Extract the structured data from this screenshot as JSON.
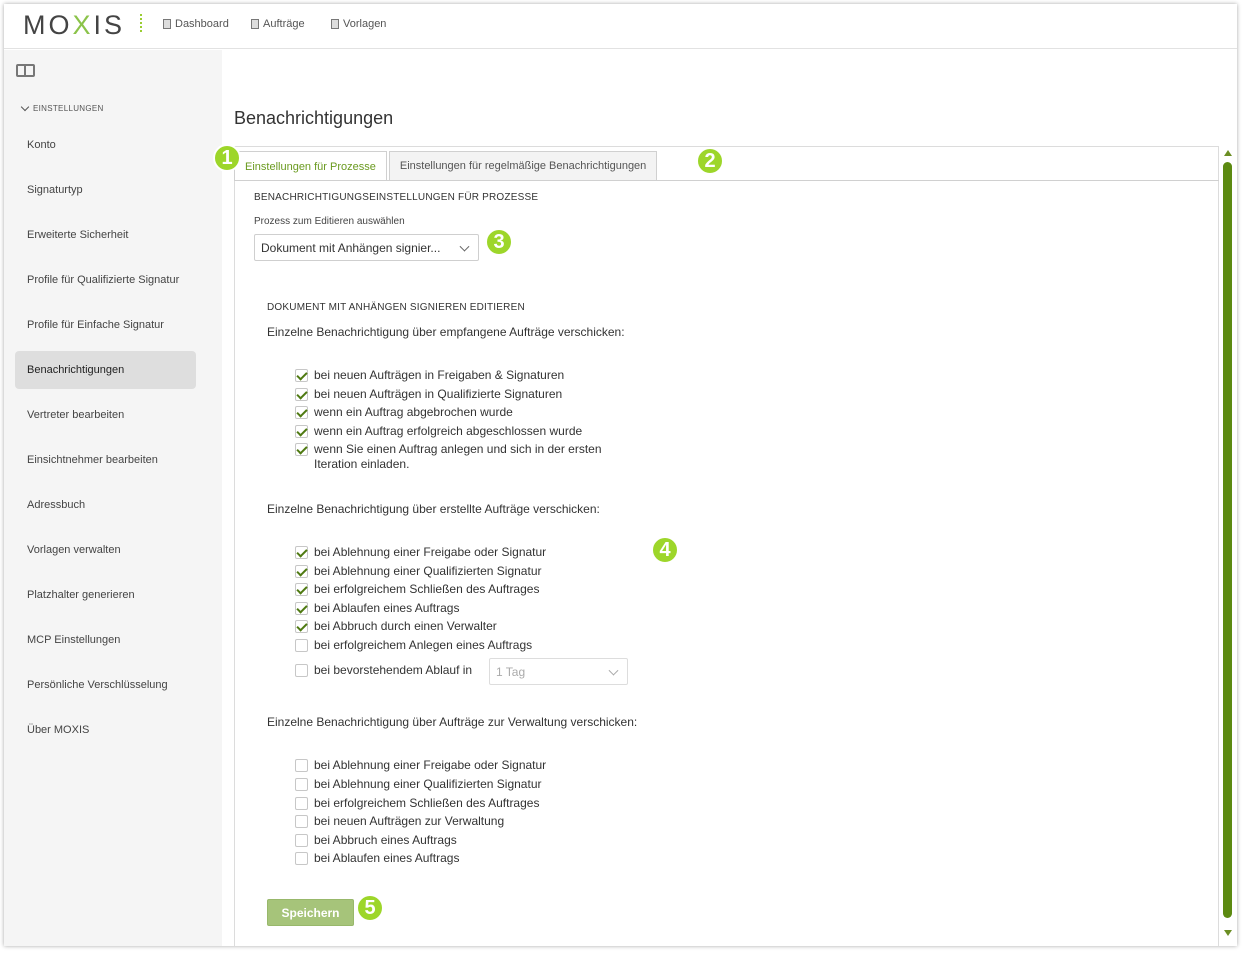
{
  "app": {
    "logo_text_1": "MO",
    "logo_x": "X",
    "logo_text_2": "IS"
  },
  "topnav": [
    {
      "label": "Dashboard"
    },
    {
      "label": "Aufträge"
    },
    {
      "label": "Vorlagen"
    }
  ],
  "sidebar": {
    "section": "EINSTELLUNGEN",
    "items": [
      {
        "label": "Konto"
      },
      {
        "label": "Signaturtyp"
      },
      {
        "label": "Erweiterte Sicherheit"
      },
      {
        "label": "Profile für Qualifizierte Signatur"
      },
      {
        "label": "Profile für Einfache Signatur"
      },
      {
        "label": "Benachrichtigungen",
        "active": true
      },
      {
        "label": "Vertreter bearbeiten"
      },
      {
        "label": "Einsichtnehmer bearbeiten"
      },
      {
        "label": "Adressbuch"
      },
      {
        "label": "Vorlagen verwalten"
      },
      {
        "label": "Platzhalter generieren"
      },
      {
        "label": "MCP Einstellungen"
      },
      {
        "label": "Persönliche Verschlüsselung"
      },
      {
        "label": "Über MOXIS"
      }
    ]
  },
  "page": {
    "title": "Benachrichtigungen",
    "tabs": [
      {
        "label": "Einstellungen für Prozesse",
        "active": true
      },
      {
        "label": "Einstellungen für regelmäßige Benachrichtigungen",
        "active": false
      }
    ],
    "section_heading": "BENACHRICHTIGUNGSEINSTELLUNGEN FÜR PROZESSE",
    "process_select_label": "Prozess zum Editieren auswählen",
    "process_select_value": "Dokument mit Anhängen signier...",
    "edit_heading": "DOKUMENT MIT ANHÄNGEN SIGNIEREN EDITIEREN",
    "group_received": {
      "label": "Einzelne Benachrichtigung über empfangene Aufträge verschicken:",
      "options": [
        {
          "label": "bei neuen Aufträgen in Freigaben & Signaturen",
          "checked": true
        },
        {
          "label": "bei neuen Aufträgen in Qualifizierte Signaturen",
          "checked": true
        },
        {
          "label": "wenn ein Auftrag abgebrochen wurde",
          "checked": true
        },
        {
          "label": "wenn ein Auftrag erfolgreich abgeschlossen wurde",
          "checked": true
        },
        {
          "label": "wenn Sie einen Auftrag anlegen und sich in der ersten",
          "label_line2": "Iteration einladen.",
          "checked": true
        }
      ]
    },
    "group_created": {
      "label": "Einzelne Benachrichtigung über erstellte Aufträge verschicken:",
      "options": [
        {
          "label": "bei Ablehnung einer Freigabe oder Signatur",
          "checked": true
        },
        {
          "label": "bei Ablehnung einer Qualifizierten Signatur",
          "checked": true
        },
        {
          "label": "bei erfolgreichem Schließen des Auftrages",
          "checked": true
        },
        {
          "label": "bei Ablaufen eines Auftrags",
          "checked": true
        },
        {
          "label": "bei Abbruch durch einen Verwalter",
          "checked": true
        },
        {
          "label": "bei erfolgreichem Anlegen eines Auftrags",
          "checked": false
        },
        {
          "label": "bei bevorstehendem Ablauf in",
          "checked": false
        }
      ],
      "expiry_select_value": "1 Tag"
    },
    "group_managed": {
      "label": "Einzelne Benachrichtigung über Aufträge zur Verwaltung verschicken:",
      "options": [
        {
          "label": "bei Ablehnung einer Freigabe oder Signatur",
          "checked": false
        },
        {
          "label": "bei Ablehnung einer Qualifizierten Signatur",
          "checked": false
        },
        {
          "label": "bei erfolgreichem Schließen des Auftrages",
          "checked": false
        },
        {
          "label": "bei neuen Aufträgen zur Verwaltung",
          "checked": false
        },
        {
          "label": "bei Abbruch eines Auftrags",
          "checked": false
        },
        {
          "label": "bei Ablaufen eines Auftrags",
          "checked": false
        }
      ]
    },
    "save_label": "Speichern"
  },
  "badges": [
    "1",
    "2",
    "3",
    "4",
    "5"
  ],
  "colors": {
    "accent": "#9dd62a",
    "brand_green": "#5c8a11",
    "save_button": "#a6c47a"
  }
}
